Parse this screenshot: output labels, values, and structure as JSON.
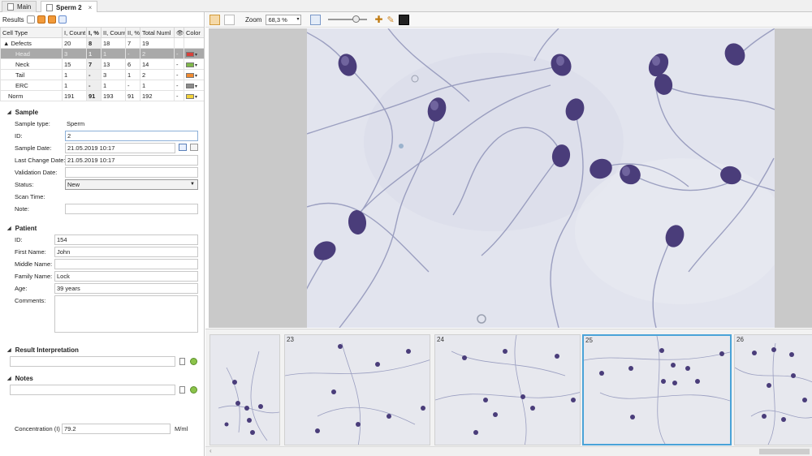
{
  "tabs": [
    {
      "label": "Main",
      "active": false
    },
    {
      "label": "Sperm 2",
      "active": true,
      "close": "×"
    }
  ],
  "results": {
    "label": "Results",
    "columns": [
      "Cell Type",
      "I, Count",
      "I, %",
      "II, Count",
      "II, %",
      "Total Numl",
      "👁",
      "Color"
    ],
    "rows": [
      {
        "type": "▲ Defects",
        "c1": "20",
        "p1": "8",
        "c2": "18",
        "p2": "7",
        "total": "19",
        "eye": "",
        "color": ""
      },
      {
        "type": "Head",
        "c1": "3",
        "p1": "1",
        "c2": "1",
        "p2": "-",
        "total": "2",
        "eye": "-",
        "color": "#d8403a"
      },
      {
        "type": "Neck",
        "c1": "15",
        "p1": "7",
        "c2": "13",
        "p2": "6",
        "total": "14",
        "eye": "-",
        "color": "#7fb84a"
      },
      {
        "type": "Tail",
        "c1": "1",
        "p1": "-",
        "c2": "3",
        "p2": "1",
        "total": "2",
        "eye": "-",
        "color": "#f08a30"
      },
      {
        "type": "ERC",
        "c1": "1",
        "p1": "-",
        "c2": "1",
        "p2": "-",
        "total": "1",
        "eye": "-",
        "color": "#8a8a8a"
      },
      {
        "type": "Norm",
        "c1": "191",
        "p1": "91",
        "c2": "193",
        "p2": "91",
        "total": "192",
        "eye": "-",
        "color": "#f2d23a"
      }
    ]
  },
  "sample": {
    "title": "Sample",
    "type_label": "Sample type:",
    "type_value": "Sperm",
    "id_label": "ID:",
    "id_value": "2",
    "date_label": "Sample Date:",
    "date_value": "21.05.2019 10:17",
    "change_label": "Last Change Date:",
    "change_value": "21.05.2019 10:17",
    "validation_label": "Validation Date:",
    "validation_value": "",
    "status_label": "Status:",
    "status_value": "New",
    "scan_label": "Scan Time:",
    "scan_value": "",
    "note_label": "Note:",
    "note_value": ""
  },
  "patient": {
    "title": "Patient",
    "id_label": "ID:",
    "id_value": "154",
    "first_label": "First Name:",
    "first_value": "John",
    "middle_label": "Middle Name:",
    "middle_value": "",
    "family_label": "Family Name:",
    "family_value": "Lock",
    "age_label": "Age:",
    "age_value": "39 years",
    "comments_label": "Comments:",
    "comments_value": ""
  },
  "interpretation": {
    "title": "Result Interpretation",
    "value": ""
  },
  "notes": {
    "title": "Notes",
    "value": ""
  },
  "concentration": {
    "label": "Concentration (I)",
    "value": "79.2",
    "unit": "M/ml"
  },
  "toolbar": {
    "zoom_label": "Zoom",
    "zoom_value": "68,3 %"
  },
  "thumbnails": [
    {
      "num": "",
      "selected": false
    },
    {
      "num": "23",
      "selected": false
    },
    {
      "num": "24",
      "selected": false
    },
    {
      "num": "25",
      "selected": true
    },
    {
      "num": "26",
      "selected": false
    }
  ],
  "colors": {
    "accent": "#4aa3d8",
    "selected_row": "#a9a9a9",
    "head_stain": "#4a3d7a",
    "tail_stain": "#8f93b8"
  }
}
